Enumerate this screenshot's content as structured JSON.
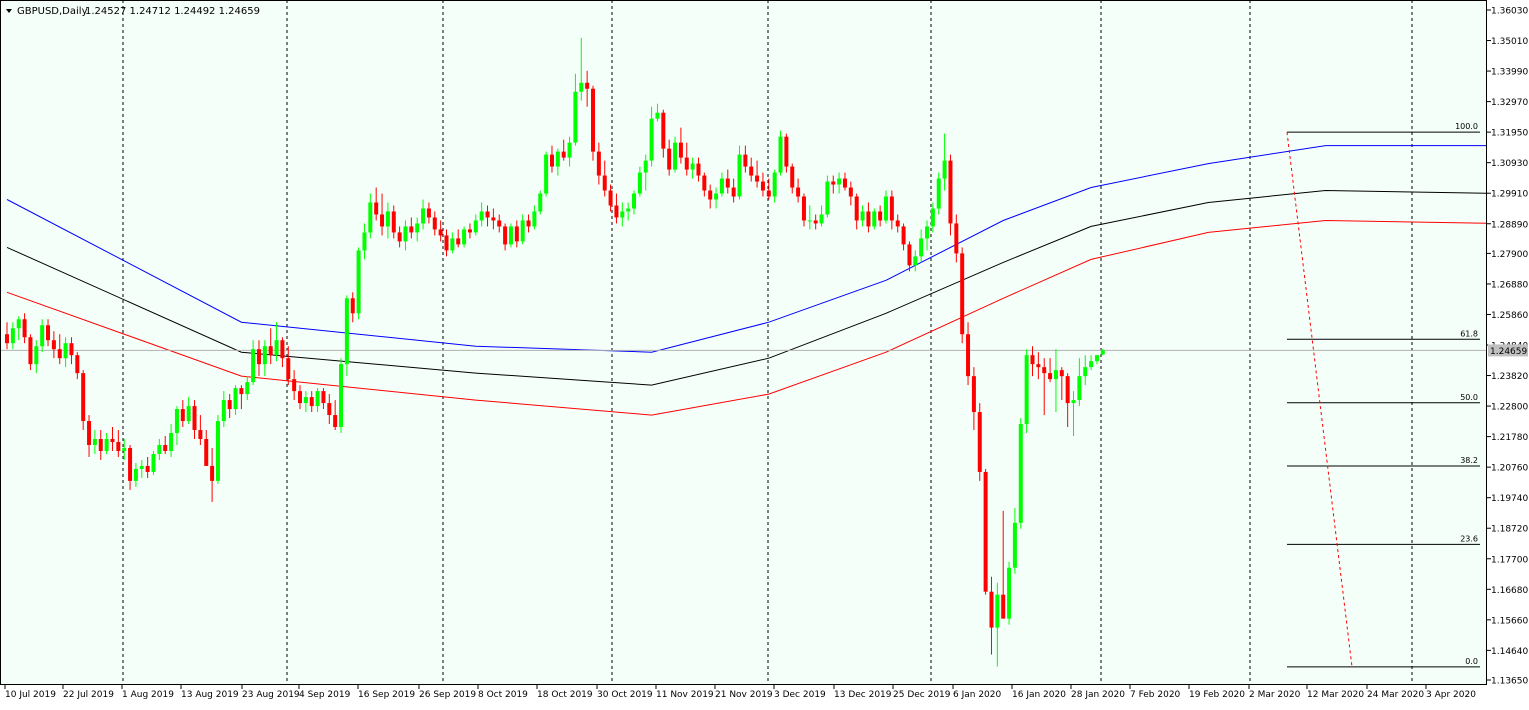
{
  "header": {
    "symbol": "GBPUSD,Daily",
    "ohlc": "1.24527 1.24712 1.24492 1.24659"
  },
  "colors": {
    "background": "#f5fffa",
    "bull": "#00ff00",
    "bear": "#ff0000",
    "ma_blue": "#0000ff",
    "ma_black": "#000000",
    "ma_red": "#ff0000",
    "price_tag": "#c0c0c0"
  },
  "chart_data": {
    "type": "candlestick",
    "title": "GBPUSD,Daily",
    "ylim": [
      1.1365,
      1.3603
    ],
    "y_ticks": [
      "1.36030",
      "1.35010",
      "1.33990",
      "1.32970",
      "1.31950",
      "1.30930",
      "1.29910",
      "1.28890",
      "1.27900",
      "1.26880",
      "1.25860",
      "1.24840",
      "1.23820",
      "1.22800",
      "1.21780",
      "1.20760",
      "1.19740",
      "1.18720",
      "1.17700",
      "1.16680",
      "1.15660",
      "1.14640",
      "1.13650"
    ],
    "x_labels": [
      "10 Jul 2019",
      "22 Jul 2019",
      "1 Aug 2019",
      "13 Aug 2019",
      "23 Aug 2019",
      "4 Sep 2019",
      "16 Sep 2019",
      "26 Sep 2019",
      "8 Oct 2019",
      "18 Oct 2019",
      "30 Oct 2019",
      "11 Nov 2019",
      "21 Nov 2019",
      "3 Dec 2019",
      "13 Dec 2019",
      "25 Dec 2019",
      "6 Jan 2020",
      "16 Jan 2020",
      "28 Jan 2020",
      "7 Feb 2020",
      "19 Feb 2020",
      "2 Mar 2020",
      "12 Mar 2020",
      "24 Mar 2020",
      "3 Apr 2020"
    ],
    "current_price": "1.24659",
    "grid": "vertical-dashed-month-separators",
    "candles": [
      [
        1.252,
        1.256,
        1.247,
        1.249
      ],
      [
        1.249,
        1.256,
        1.247,
        1.254
      ],
      [
        1.254,
        1.258,
        1.25,
        1.257
      ],
      [
        1.257,
        1.259,
        1.249,
        1.251
      ],
      [
        1.251,
        1.252,
        1.24,
        1.242
      ],
      [
        1.242,
        1.25,
        1.239,
        1.248
      ],
      [
        1.248,
        1.257,
        1.246,
        1.255
      ],
      [
        1.255,
        1.257,
        1.248,
        1.25
      ],
      [
        1.25,
        1.253,
        1.244,
        1.247
      ],
      [
        1.247,
        1.252,
        1.242,
        1.244
      ],
      [
        1.244,
        1.251,
        1.241,
        1.249
      ],
      [
        1.249,
        1.251,
        1.242,
        1.245
      ],
      [
        1.245,
        1.246,
        1.237,
        1.239
      ],
      [
        1.239,
        1.24,
        1.22,
        1.223
      ],
      [
        1.223,
        1.225,
        1.211,
        1.215
      ],
      [
        1.215,
        1.22,
        1.212,
        1.217
      ],
      [
        1.217,
        1.22,
        1.21,
        1.213
      ],
      [
        1.213,
        1.219,
        1.212,
        1.217
      ],
      [
        1.217,
        1.221,
        1.213,
        1.216
      ],
      [
        1.216,
        1.22,
        1.211,
        1.213
      ],
      [
        1.213,
        1.217,
        1.21,
        1.214
      ],
      [
        1.214,
        1.215,
        1.2,
        1.203
      ],
      [
        1.203,
        1.209,
        1.201,
        1.207
      ],
      [
        1.207,
        1.21,
        1.204,
        1.208
      ],
      [
        1.208,
        1.211,
        1.204,
        1.206
      ],
      [
        1.206,
        1.213,
        1.205,
        1.212
      ],
      [
        1.212,
        1.217,
        1.21,
        1.215
      ],
      [
        1.215,
        1.218,
        1.212,
        1.213
      ],
      [
        1.213,
        1.222,
        1.211,
        1.219
      ],
      [
        1.219,
        1.228,
        1.215,
        1.227
      ],
      [
        1.227,
        1.23,
        1.221,
        1.223
      ],
      [
        1.223,
        1.231,
        1.222,
        1.228
      ],
      [
        1.228,
        1.23,
        1.217,
        1.22
      ],
      [
        1.22,
        1.225,
        1.215,
        1.217
      ],
      [
        1.217,
        1.22,
        1.208,
        1.208
      ],
      [
        1.208,
        1.214,
        1.196,
        1.203
      ],
      [
        1.203,
        1.225,
        1.202,
        1.223
      ],
      [
        1.223,
        1.233,
        1.221,
        1.23
      ],
      [
        1.23,
        1.232,
        1.224,
        1.227
      ],
      [
        1.227,
        1.235,
        1.225,
        1.234
      ],
      [
        1.234,
        1.235,
        1.227,
        1.232
      ],
      [
        1.232,
        1.238,
        1.23,
        1.236
      ],
      [
        1.236,
        1.25,
        1.235,
        1.247
      ],
      [
        1.247,
        1.25,
        1.238,
        1.242
      ],
      [
        1.242,
        1.25,
        1.238,
        1.248
      ],
      [
        1.248,
        1.254,
        1.242,
        1.245
      ],
      [
        1.245,
        1.256,
        1.243,
        1.25
      ],
      [
        1.25,
        1.251,
        1.241,
        1.244
      ],
      [
        1.244,
        1.248,
        1.235,
        1.237
      ],
      [
        1.237,
        1.24,
        1.23,
        1.233
      ],
      [
        1.233,
        1.235,
        1.227,
        1.229
      ],
      [
        1.229,
        1.233,
        1.226,
        1.231
      ],
      [
        1.231,
        1.233,
        1.226,
        1.228
      ],
      [
        1.228,
        1.234,
        1.226,
        1.233
      ],
      [
        1.233,
        1.234,
        1.227,
        1.229
      ],
      [
        1.229,
        1.232,
        1.222,
        1.225
      ],
      [
        1.225,
        1.23,
        1.22,
        1.221
      ],
      [
        1.221,
        1.244,
        1.219,
        1.242
      ],
      [
        1.242,
        1.265,
        1.238,
        1.264
      ],
      [
        1.264,
        1.266,
        1.256,
        1.259
      ],
      [
        1.259,
        1.281,
        1.257,
        1.28
      ],
      [
        1.28,
        1.289,
        1.277,
        1.286
      ],
      [
        1.286,
        1.299,
        1.284,
        1.296
      ],
      [
        1.296,
        1.301,
        1.29,
        1.292
      ],
      [
        1.292,
        1.299,
        1.285,
        1.288
      ],
      [
        1.288,
        1.296,
        1.284,
        1.293
      ],
      [
        1.293,
        1.295,
        1.284,
        1.286
      ],
      [
        1.286,
        1.288,
        1.281,
        1.283
      ],
      [
        1.283,
        1.29,
        1.28,
        1.288
      ],
      [
        1.288,
        1.291,
        1.284,
        1.286
      ],
      [
        1.286,
        1.291,
        1.283,
        1.289
      ],
      [
        1.289,
        1.297,
        1.287,
        1.294
      ],
      [
        1.294,
        1.296,
        1.289,
        1.291
      ],
      [
        1.291,
        1.293,
        1.285,
        1.287
      ],
      [
        1.287,
        1.29,
        1.283,
        1.285
      ],
      [
        1.285,
        1.287,
        1.278,
        1.28
      ],
      [
        1.28,
        1.286,
        1.279,
        1.284
      ],
      [
        1.284,
        1.287,
        1.281,
        1.282
      ],
      [
        1.282,
        1.288,
        1.281,
        1.287
      ],
      [
        1.287,
        1.289,
        1.284,
        1.286
      ],
      [
        1.286,
        1.292,
        1.285,
        1.29
      ],
      [
        1.29,
        1.296,
        1.288,
        1.293
      ],
      [
        1.293,
        1.295,
        1.288,
        1.291
      ],
      [
        1.291,
        1.294,
        1.287,
        1.29
      ],
      [
        1.29,
        1.292,
        1.286,
        1.288
      ],
      [
        1.288,
        1.289,
        1.28,
        1.282
      ],
      [
        1.282,
        1.289,
        1.281,
        1.288
      ],
      [
        1.288,
        1.29,
        1.281,
        1.283
      ],
      [
        1.283,
        1.292,
        1.282,
        1.29
      ],
      [
        1.29,
        1.292,
        1.286,
        1.288
      ],
      [
        1.288,
        1.295,
        1.287,
        1.293
      ],
      [
        1.293,
        1.3,
        1.292,
        1.299
      ],
      [
        1.299,
        1.313,
        1.298,
        1.312
      ],
      [
        1.312,
        1.315,
        1.306,
        1.308
      ],
      [
        1.308,
        1.314,
        1.305,
        1.313
      ],
      [
        1.313,
        1.317,
        1.31,
        1.311
      ],
      [
        1.311,
        1.318,
        1.308,
        1.316
      ],
      [
        1.316,
        1.339,
        1.315,
        1.333
      ],
      [
        1.333,
        1.351,
        1.33,
        1.336
      ],
      [
        1.336,
        1.34,
        1.328,
        1.334
      ],
      [
        1.334,
        1.335,
        1.31,
        1.313
      ],
      [
        1.313,
        1.316,
        1.302,
        1.305
      ],
      [
        1.305,
        1.31,
        1.298,
        1.3
      ],
      [
        1.3,
        1.302,
        1.293,
        1.295
      ],
      [
        1.295,
        1.299,
        1.289,
        1.291
      ],
      [
        1.291,
        1.296,
        1.288,
        1.293
      ],
      [
        1.293,
        1.296,
        1.29,
        1.294
      ],
      [
        1.294,
        1.3,
        1.292,
        1.299
      ],
      [
        1.299,
        1.308,
        1.298,
        1.306
      ],
      [
        1.306,
        1.312,
        1.3,
        1.31
      ],
      [
        1.31,
        1.328,
        1.308,
        1.324
      ],
      [
        1.324,
        1.329,
        1.323,
        1.326
      ],
      [
        1.326,
        1.327,
        1.311,
        1.314
      ],
      [
        1.314,
        1.317,
        1.305,
        1.307
      ],
      [
        1.307,
        1.318,
        1.306,
        1.316
      ],
      [
        1.316,
        1.321,
        1.309,
        1.311
      ],
      [
        1.311,
        1.316,
        1.305,
        1.307
      ],
      [
        1.307,
        1.311,
        1.304,
        1.309
      ],
      [
        1.309,
        1.311,
        1.303,
        1.305
      ],
      [
        1.305,
        1.306,
        1.298,
        1.3
      ],
      [
        1.3,
        1.302,
        1.294,
        1.297
      ],
      [
        1.297,
        1.301,
        1.294,
        1.299
      ],
      [
        1.299,
        1.306,
        1.298,
        1.304
      ],
      [
        1.304,
        1.307,
        1.299,
        1.301
      ],
      [
        1.301,
        1.304,
        1.296,
        1.298
      ],
      [
        1.298,
        1.315,
        1.297,
        1.312
      ],
      [
        1.312,
        1.315,
        1.306,
        1.308
      ],
      [
        1.308,
        1.311,
        1.303,
        1.305
      ],
      [
        1.305,
        1.31,
        1.301,
        1.303
      ],
      [
        1.303,
        1.306,
        1.298,
        1.3
      ],
      [
        1.3,
        1.304,
        1.297,
        1.298
      ],
      [
        1.298,
        1.307,
        1.296,
        1.306
      ],
      [
        1.306,
        1.32,
        1.305,
        1.318
      ],
      [
        1.318,
        1.319,
        1.306,
        1.308
      ],
      [
        1.308,
        1.309,
        1.299,
        1.301
      ],
      [
        1.301,
        1.304,
        1.296,
        1.298
      ],
      [
        1.298,
        1.299,
        1.288,
        1.29
      ],
      [
        1.29,
        1.295,
        1.287,
        1.29
      ],
      [
        1.29,
        1.292,
        1.287,
        1.289
      ],
      [
        1.289,
        1.295,
        1.288,
        1.292
      ],
      [
        1.292,
        1.305,
        1.291,
        1.303
      ],
      [
        1.303,
        1.305,
        1.299,
        1.302
      ],
      [
        1.302,
        1.306,
        1.299,
        1.304
      ],
      [
        1.304,
        1.306,
        1.3,
        1.301
      ],
      [
        1.301,
        1.303,
        1.295,
        1.298
      ],
      [
        1.298,
        1.299,
        1.287,
        1.29
      ],
      [
        1.29,
        1.295,
        1.288,
        1.293
      ],
      [
        1.293,
        1.296,
        1.286,
        1.288
      ],
      [
        1.288,
        1.294,
        1.287,
        1.293
      ],
      [
        1.293,
        1.295,
        1.288,
        1.29
      ],
      [
        1.29,
        1.3,
        1.289,
        1.298
      ],
      [
        1.298,
        1.3,
        1.287,
        1.29
      ],
      [
        1.29,
        1.292,
        1.286,
        1.288
      ],
      [
        1.288,
        1.289,
        1.28,
        1.282
      ],
      [
        1.282,
        1.283,
        1.273,
        1.275
      ],
      [
        1.275,
        1.28,
        1.273,
        1.278
      ],
      [
        1.278,
        1.287,
        1.276,
        1.284
      ],
      [
        1.284,
        1.29,
        1.28,
        1.288
      ],
      [
        1.288,
        1.296,
        1.286,
        1.294
      ],
      [
        1.294,
        1.306,
        1.292,
        1.304
      ],
      [
        1.304,
        1.319,
        1.3,
        1.31
      ],
      [
        1.31,
        1.312,
        1.285,
        1.289
      ],
      [
        1.289,
        1.292,
        1.276,
        1.279
      ],
      [
        1.279,
        1.281,
        1.249,
        1.252
      ],
      [
        1.252,
        1.256,
        1.235,
        1.238
      ],
      [
        1.238,
        1.241,
        1.22,
        1.226
      ],
      [
        1.226,
        1.229,
        1.203,
        1.206
      ],
      [
        1.206,
        1.207,
        1.165,
        1.166
      ],
      [
        1.166,
        1.171,
        1.145,
        1.154
      ],
      [
        1.154,
        1.169,
        1.141,
        1.165
      ],
      [
        1.165,
        1.193,
        1.161,
        1.157
      ],
      [
        1.157,
        1.176,
        1.155,
        1.174
      ],
      [
        1.174,
        1.194,
        1.172,
        1.189
      ],
      [
        1.189,
        1.224,
        1.187,
        1.222
      ],
      [
        1.222,
        1.247,
        1.219,
        1.245
      ],
      [
        1.245,
        1.248,
        1.238,
        1.242
      ],
      [
        1.242,
        1.246,
        1.237,
        1.241
      ],
      [
        1.241,
        1.244,
        1.225,
        1.239
      ],
      [
        1.239,
        1.244,
        1.236,
        1.237
      ],
      [
        1.237,
        1.247,
        1.226,
        1.24
      ],
      [
        1.24,
        1.241,
        1.23,
        1.238
      ],
      [
        1.238,
        1.239,
        1.221,
        1.229
      ],
      [
        1.229,
        1.233,
        1.218,
        1.23
      ],
      [
        1.23,
        1.244,
        1.228,
        1.238
      ],
      [
        1.238,
        1.245,
        1.235,
        1.241
      ],
      [
        1.241,
        1.245,
        1.24,
        1.243
      ],
      [
        1.243,
        1.245,
        1.242,
        1.245
      ],
      [
        1.2453,
        1.2471,
        1.2449,
        1.2466
      ]
    ],
    "ma_blue": [
      [
        0,
        1.297
      ],
      [
        40,
        1.256
      ],
      [
        80,
        1.248
      ],
      [
        110,
        1.246
      ],
      [
        130,
        1.256
      ],
      [
        150,
        1.27
      ],
      [
        170,
        1.29
      ],
      [
        185,
        1.301
      ],
      [
        205,
        1.309
      ],
      [
        225,
        1.315
      ],
      [
        253,
        1.315
      ],
      [
        275,
        1.302
      ],
      [
        295,
        1.293
      ],
      [
        315,
        1.285
      ]
    ],
    "ma_black": [
      [
        0,
        1.281
      ],
      [
        40,
        1.246
      ],
      [
        80,
        1.239
      ],
      [
        110,
        1.235
      ],
      [
        130,
        1.244
      ],
      [
        150,
        1.259
      ],
      [
        170,
        1.276
      ],
      [
        185,
        1.288
      ],
      [
        205,
        1.296
      ],
      [
        225,
        1.3
      ],
      [
        255,
        1.299
      ],
      [
        275,
        1.285
      ],
      [
        295,
        1.277
      ],
      [
        315,
        1.27
      ]
    ],
    "ma_red": [
      [
        0,
        1.266
      ],
      [
        40,
        1.238
      ],
      [
        80,
        1.23
      ],
      [
        110,
        1.225
      ],
      [
        130,
        1.232
      ],
      [
        150,
        1.246
      ],
      [
        170,
        1.264
      ],
      [
        185,
        1.277
      ],
      [
        205,
        1.286
      ],
      [
        225,
        1.29
      ],
      [
        255,
        1.289
      ],
      [
        275,
        1.272
      ],
      [
        295,
        1.264
      ],
      [
        315,
        1.256
      ]
    ],
    "fibonacci": {
      "levels": [
        {
          "label": "100.0",
          "price": 1.3195
        },
        {
          "label": "61.8",
          "price": 1.2503
        },
        {
          "label": "50.0",
          "price": 1.2291
        },
        {
          "label": "38.2",
          "price": 1.208
        },
        {
          "label": "23.6",
          "price": 1.1818
        },
        {
          "label": "0.0",
          "price": 1.1409
        }
      ]
    }
  }
}
